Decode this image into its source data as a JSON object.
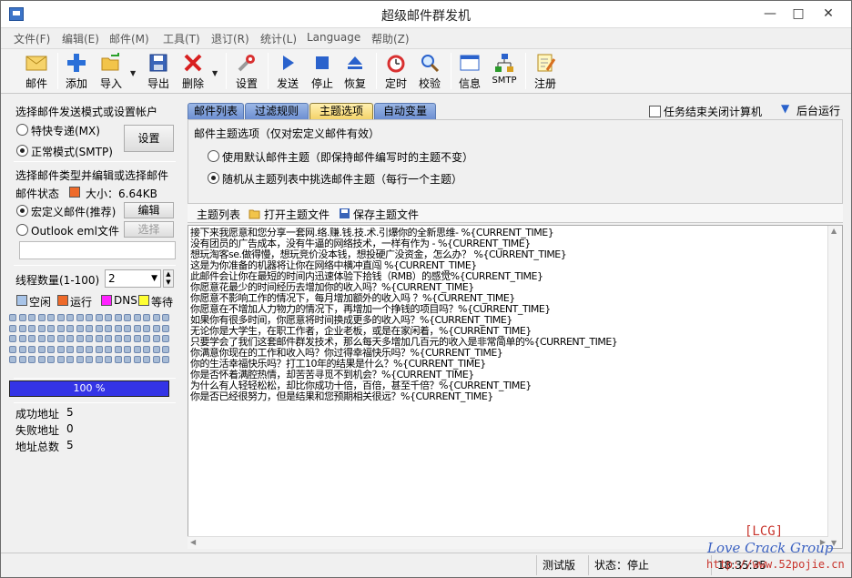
{
  "window": {
    "title": "超级邮件群发机"
  },
  "menu": [
    "文件(F)",
    "编辑(E)",
    "邮件(M)",
    "工具(T)",
    "退订(R)",
    "统计(L)",
    "Language",
    "帮助(Z)"
  ],
  "toolbar": {
    "mail": "邮件",
    "add": "添加",
    "import": "导入",
    "export": "导出",
    "delete": "删除",
    "settings": "设置",
    "send": "发送",
    "stop": "停止",
    "restore": "恢复",
    "timer": "定时",
    "check": "校验",
    "info": "信息",
    "smtp": "SMTP",
    "register": "注册"
  },
  "left": {
    "mode_title": "选择邮件发送模式或设置帐户",
    "mode_express": "特快专递(MX)",
    "mode_normal": "正常模式(SMTP)",
    "settings_btn": "设置",
    "type_title": "选择邮件类型并编辑或选择邮件",
    "status_label": "邮件状态",
    "size_text": "大小：6.64KB",
    "macro_mail": "宏定义邮件(推荐)",
    "edit_btn": "编辑",
    "outlook_file": "Outlook eml文件",
    "select_btn": "选择",
    "eml_path": "",
    "threads_label": "线程数量(1-100)",
    "threads_value": "2",
    "legend": {
      "idle": "空闲",
      "running": "运行",
      "dns": "DNS",
      "waiting": "等待"
    },
    "progress": {
      "text": "100 %",
      "value": 1.0
    },
    "stats": {
      "success_label": "成功地址",
      "success_value": "5",
      "fail_label": "失败地址",
      "fail_value": "0",
      "total_label": "地址总数",
      "total_value": "5"
    }
  },
  "tabs": [
    "邮件列表",
    "过滤规则",
    "主题选项",
    "自动变量"
  ],
  "active_tab": "主题选项",
  "right": {
    "shutdown_label": "任务结束关闭计算机",
    "background_label": "后台运行",
    "subject_title": "邮件主题选项（仅对宏定义邮件有效）",
    "opt_default": "使用默认邮件主题（即保持邮件编写时的主题不变）",
    "opt_random": "随机从主题列表中挑选邮件主题（每行一个主题）",
    "subject_list_label": "主题列表",
    "open_file": "打开主题文件",
    "save_file": "保存主题文件",
    "subjects": [
      "接下来我愿意和您分享一套网.络.赚.钱.技.术.引爆你的全新思维- %{CURRENT_TIME}",
      "没有团员的广告成本，没有牛逼的网络技术，一样有作为 - %{CURRENT_TIME}",
      "想玩淘客se.做得慢，想玩竞价没本钱，想投硬广没资金，怎么办？ %{CURRENT_TIME}",
      "这是为你准备的机器将让你在网络中横冲直闯 %{CURRENT_TIME}",
      "此邮件会让你在最短的时间内迅速体验下拾钱（RMB）的感觉%{CURRENT_TIME}",
      "你愿意花最少的时间经历去增加你的收入吗？%{CURRENT_TIME}",
      "你愿意不影响工作的情况下，每月增加额外的收入吗 ？%{CURRENT_TIME}",
      "你愿意在不增加人力物力的情况下，再增加一个挣钱的项目吗？%{CURRENT_TIME}",
      "如果你有很多时间，你愿意将时间换成更多的收入吗？%{CURRENT_TIME}",
      "无论你是大学生，在职工作者，企业老板，或是在家闲着，%{CURRENT_TIME}",
      "只要学会了我们这套邮件群发技术，那么每天多增加几百元的收入是非常简单的%{CURRENT_TIME}",
      "你满意你现在的工作和收入吗？你过得幸福快乐吗？%{CURRENT_TIME}",
      "你的生活幸福快乐吗？打工10年的结果是什么？%{CURRENT_TIME}",
      "你是否怀着满腔热情，却苦苦寻觅不到机会？%{CURRENT_TIME}",
      "为什么有人轻轻松松，却比你成功十倍，百倍，甚至千倍？%{CURRENT_TIME}",
      "你是否已经很努力，但是结果和您预期相关很远？%{CURRENT_TIME}"
    ]
  },
  "status": {
    "edition": "测试版",
    "state": "状态：停止",
    "time": "18:35:35"
  },
  "watermark": {
    "line1": "[LCG]",
    "line2": "Love Crack Group",
    "line3": "http://www.52pojie.cn"
  },
  "colors": {
    "running": "#ee6a2a",
    "dns": "#ff22ff",
    "waiting": "#ffff33",
    "idle": "#a8c4e8",
    "progress": "#3434e6",
    "tab_active": "#f4d36a",
    "tab": "#7b9ad6"
  }
}
